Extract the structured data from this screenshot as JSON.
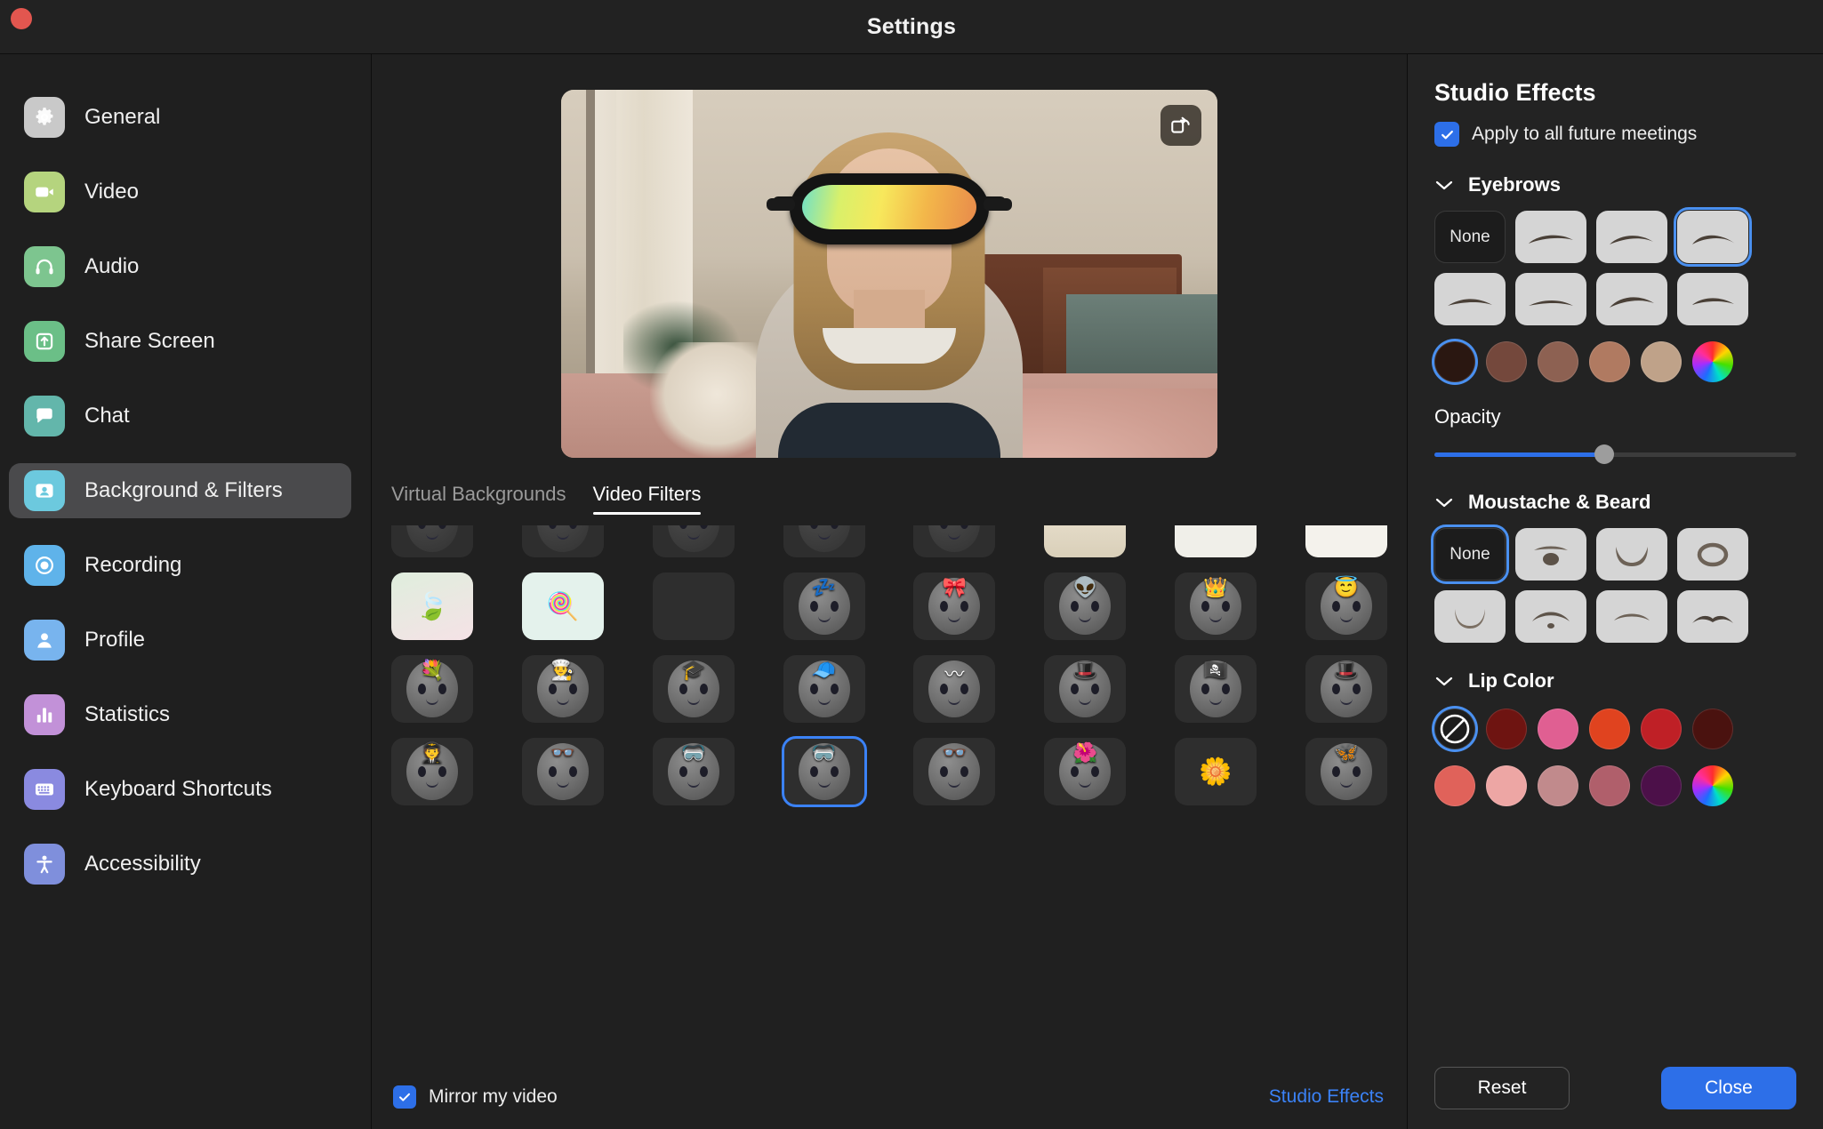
{
  "window": {
    "title": "Settings",
    "close_button": "close-window"
  },
  "sidebar": {
    "items": [
      {
        "label": "General",
        "icon": "gear-icon",
        "color": "#c9c9c9",
        "active": false
      },
      {
        "label": "Video",
        "icon": "video-camera-icon",
        "color": "#b5d47e",
        "active": false
      },
      {
        "label": "Audio",
        "icon": "headphones-icon",
        "color": "#7dc58f",
        "active": false
      },
      {
        "label": "Share Screen",
        "icon": "upload-icon",
        "color": "#6bbf87",
        "active": false
      },
      {
        "label": "Chat",
        "icon": "chat-bubble-icon",
        "color": "#63b6ab",
        "active": false
      },
      {
        "label": "Background & Filters",
        "icon": "person-card-icon",
        "color": "#6cc9de",
        "active": true
      },
      {
        "label": "Recording",
        "icon": "record-icon",
        "color": "#5fb3ea",
        "active": false
      },
      {
        "label": "Profile",
        "icon": "person-icon",
        "color": "#78b4ee",
        "active": false
      },
      {
        "label": "Statistics",
        "icon": "bar-chart-icon",
        "color": "#c291d8",
        "active": false
      },
      {
        "label": "Keyboard Shortcuts",
        "icon": "keyboard-icon",
        "color": "#8a8ae0",
        "active": false
      },
      {
        "label": "Accessibility",
        "icon": "accessibility-icon",
        "color": "#7f8fdc",
        "active": false
      }
    ]
  },
  "preview": {
    "pip_button": "flip-camera-button"
  },
  "tabs": [
    {
      "label": "Virtual Backgrounds",
      "active": false
    },
    {
      "label": "Video Filters",
      "active": true
    }
  ],
  "filters": [
    {
      "name": "pig-nose",
      "selected": false,
      "badge": "🐷",
      "cut": true
    },
    {
      "name": "cat-face",
      "selected": false,
      "badge": "🐱",
      "cut": true
    },
    {
      "name": "dog-face",
      "selected": false,
      "badge": "🐶",
      "cut": true
    },
    {
      "name": "plain-face",
      "selected": false,
      "badge": "",
      "cut": true
    },
    {
      "name": "shark-mouth",
      "selected": false,
      "badge": "🦈",
      "cut": true
    },
    {
      "name": "room-frame",
      "selected": false,
      "badge": "",
      "cut": true
    },
    {
      "name": "white-frame",
      "selected": false,
      "badge": "",
      "cut": true
    },
    {
      "name": "arch-frame",
      "selected": false,
      "badge": "",
      "cut": true
    },
    {
      "name": "leaf-frame",
      "selected": false,
      "badge": "🍃",
      "cut": false
    },
    {
      "name": "lollipop-frame",
      "selected": false,
      "badge": "🍭",
      "cut": false
    },
    {
      "name": "loading-bar",
      "selected": false,
      "badge": "",
      "cut": false
    },
    {
      "name": "sleepy-face",
      "selected": false,
      "badge": "💤",
      "cut": false
    },
    {
      "name": "red-bandana",
      "selected": false,
      "badge": "🎀",
      "cut": false
    },
    {
      "name": "alien-face",
      "selected": false,
      "badge": "👽",
      "cut": false
    },
    {
      "name": "crown-face",
      "selected": false,
      "badge": "👑",
      "cut": false
    },
    {
      "name": "halo-face",
      "selected": false,
      "badge": "😇",
      "cut": false
    },
    {
      "name": "flower-crown",
      "selected": false,
      "badge": "💐",
      "cut": false
    },
    {
      "name": "chef-hat",
      "selected": false,
      "badge": "👨‍🍳",
      "cut": false
    },
    {
      "name": "graduation-cap",
      "selected": false,
      "badge": "🎓",
      "cut": false
    },
    {
      "name": "red-beret",
      "selected": false,
      "badge": "🧢",
      "cut": false
    },
    {
      "name": "moustache-face",
      "selected": false,
      "badge": "〰",
      "cut": false
    },
    {
      "name": "bandit-mask",
      "selected": false,
      "badge": "🎩",
      "cut": false
    },
    {
      "name": "pirate-hat",
      "selected": false,
      "badge": "🏴‍☠️",
      "cut": false
    },
    {
      "name": "fedora-hat",
      "selected": false,
      "badge": "🎩",
      "cut": false
    },
    {
      "name": "captain-hat",
      "selected": false,
      "badge": "🧑‍✈️",
      "cut": false
    },
    {
      "name": "3d-glasses",
      "selected": false,
      "badge": "👓",
      "cut": false
    },
    {
      "name": "vr-headset",
      "selected": false,
      "badge": "🥽",
      "cut": false
    },
    {
      "name": "ski-goggles",
      "selected": true,
      "badge": "🥽",
      "cut": false
    },
    {
      "name": "round-glasses",
      "selected": false,
      "badge": "👓",
      "cut": false
    },
    {
      "name": "flower-wreath",
      "selected": false,
      "badge": "🌺",
      "cut": false
    },
    {
      "name": "daisy-flower",
      "selected": false,
      "badge": "🌼",
      "cut": false
    },
    {
      "name": "butterfly-face",
      "selected": false,
      "badge": "🦋",
      "cut": false
    }
  ],
  "bottom": {
    "mirror_label": "Mirror my video",
    "mirror_checked": true,
    "studio_effects_link": "Studio Effects"
  },
  "studio": {
    "title": "Studio Effects",
    "apply_all_label": "Apply to all future meetings",
    "apply_all_checked": true,
    "sections": {
      "eyebrows": {
        "title": "Eyebrows",
        "expanded": true,
        "none_label": "None",
        "selected_index": 2,
        "options_count": 7,
        "colors": [
          "#2a1711",
          "#74483c",
          "#8d6152",
          "#b07a61",
          "#bfa289"
        ],
        "color_selected_index": 0,
        "color_wheel": "color-wheel",
        "opacity_label": "Opacity",
        "opacity_percent": 47
      },
      "moustache_beard": {
        "title": "Moustache & Beard",
        "expanded": true,
        "none_label": "None",
        "selected_index": -1,
        "none_selected": true,
        "options_count": 7
      },
      "lip_color": {
        "title": "Lip Color",
        "expanded": true,
        "none_selected": true,
        "colors_row1": [
          "#6e1411",
          "#e05f92",
          "#e0431f",
          "#bf2026",
          "#4a120f"
        ],
        "colors_row2": [
          "#e0625a",
          "#eda6a4",
          "#c18a8c",
          "#b05f6b",
          "#4c1049"
        ],
        "color_wheel": "color-wheel"
      }
    },
    "reset_label": "Reset",
    "close_label": "Close"
  },
  "colors": {
    "accent_blue": "#2d6fe8",
    "selection_blue": "#4a90f0",
    "window_bg": "#1e1e1e",
    "sidebar_bg": "#1f1f1f",
    "panel_bg": "#232323"
  }
}
